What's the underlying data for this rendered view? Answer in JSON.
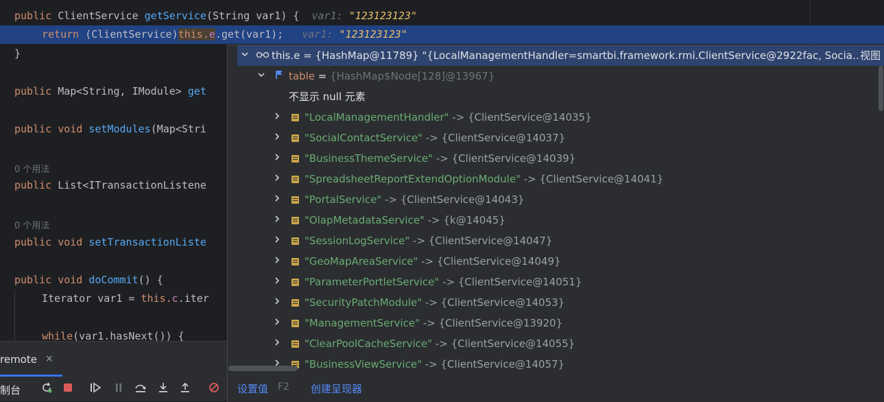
{
  "editor": {
    "line1": {
      "kw": "public",
      "type": " ClientService ",
      "fn": "getService",
      "rest": "(String var1) {",
      "hint_name": "var1:",
      "hint_value": "\"123123123\""
    },
    "line2": {
      "kw": "return",
      "pre": " (ClientService)",
      "this": "this.",
      "fld": "e",
      "rest": ".get(var1);",
      "hint_name": "var1:",
      "hint_value": "\"123123123\""
    },
    "line3": "}",
    "line4": {
      "kw": "public",
      "type": " Map<String, IModule> ",
      "fn": "get"
    },
    "line5": {
      "kw": "public",
      "kw2": " void ",
      "fn": "setModules",
      "rest": "(Map<Stri"
    },
    "usage1": "0 个用法",
    "line6": {
      "kw": "public",
      "type": " List<ITransactionListene"
    },
    "usage2": "0 个用法",
    "line7": {
      "kw": "public",
      "kw2": " void ",
      "fn": "setTransactionListe"
    },
    "line8": {
      "kw": "public",
      "kw2": " void ",
      "fn": "doCommit",
      "rest": "() {"
    },
    "line9": {
      "pre": "Iterator var1 = ",
      "this": "this.",
      "fld": "c",
      "rest": ".iter"
    },
    "line10": {
      "kw": "while",
      "rest": "(var1.hasNext()) {"
    }
  },
  "tool": {
    "tab_label": "remote",
    "tab_close": "×",
    "console_label": "制台"
  },
  "popup": {
    "root": {
      "icon": "oo",
      "label": "this.e = {HashMap@11789} \"{LocalManagementHandler=smartbi.framework.rmi.ClientService@2922fac, Socia…",
      "view_link": "视图"
    },
    "table": {
      "name": "table",
      "eq": " = ",
      "value": "{HashMap$Node[128]@13967}"
    },
    "null_msg": "不显示 null 元素",
    "entries": [
      {
        "key": "\"LocalManagementHandler\"",
        "val": "{ClientService@14035}"
      },
      {
        "key": "\"SocialContactService\"",
        "val": "{ClientService@14037}"
      },
      {
        "key": "\"BusinessThemeService\"",
        "val": "{ClientService@14039}"
      },
      {
        "key": "\"SpreadsheetReportExtendOptionModule\"",
        "val": "{ClientService@14041}"
      },
      {
        "key": "\"PortalService\"",
        "val": "{ClientService@14043}"
      },
      {
        "key": "\"OlapMetadataService\"",
        "val": "{k@14045}"
      },
      {
        "key": "\"SessionLogService\"",
        "val": "{ClientService@14047}"
      },
      {
        "key": "\"GeoMapAreaService\"",
        "val": "{ClientService@14049}"
      },
      {
        "key": "\"ParameterPortletService\"",
        "val": "{ClientService@14051}"
      },
      {
        "key": "\"SecurityPatchModule\"",
        "val": "{ClientService@14053}"
      },
      {
        "key": "\"ManagementService\"",
        "val": "{ClientService@13920}"
      },
      {
        "key": "\"ClearPoolCacheService\"",
        "val": "{ClientService@14055}"
      },
      {
        "key": "\"BusinessViewService\"",
        "val": "{ClientService@14057}"
      }
    ],
    "arrow": " -> ",
    "footer": {
      "set_value": "设置值",
      "set_value_key": "F2",
      "create_renderer": "创建呈现器"
    }
  },
  "colors": {
    "selection": "#214283",
    "popup_bg": "#2b2d30",
    "string": "#6aab73",
    "keyword": "#cf8e6d",
    "link": "#548af7"
  }
}
